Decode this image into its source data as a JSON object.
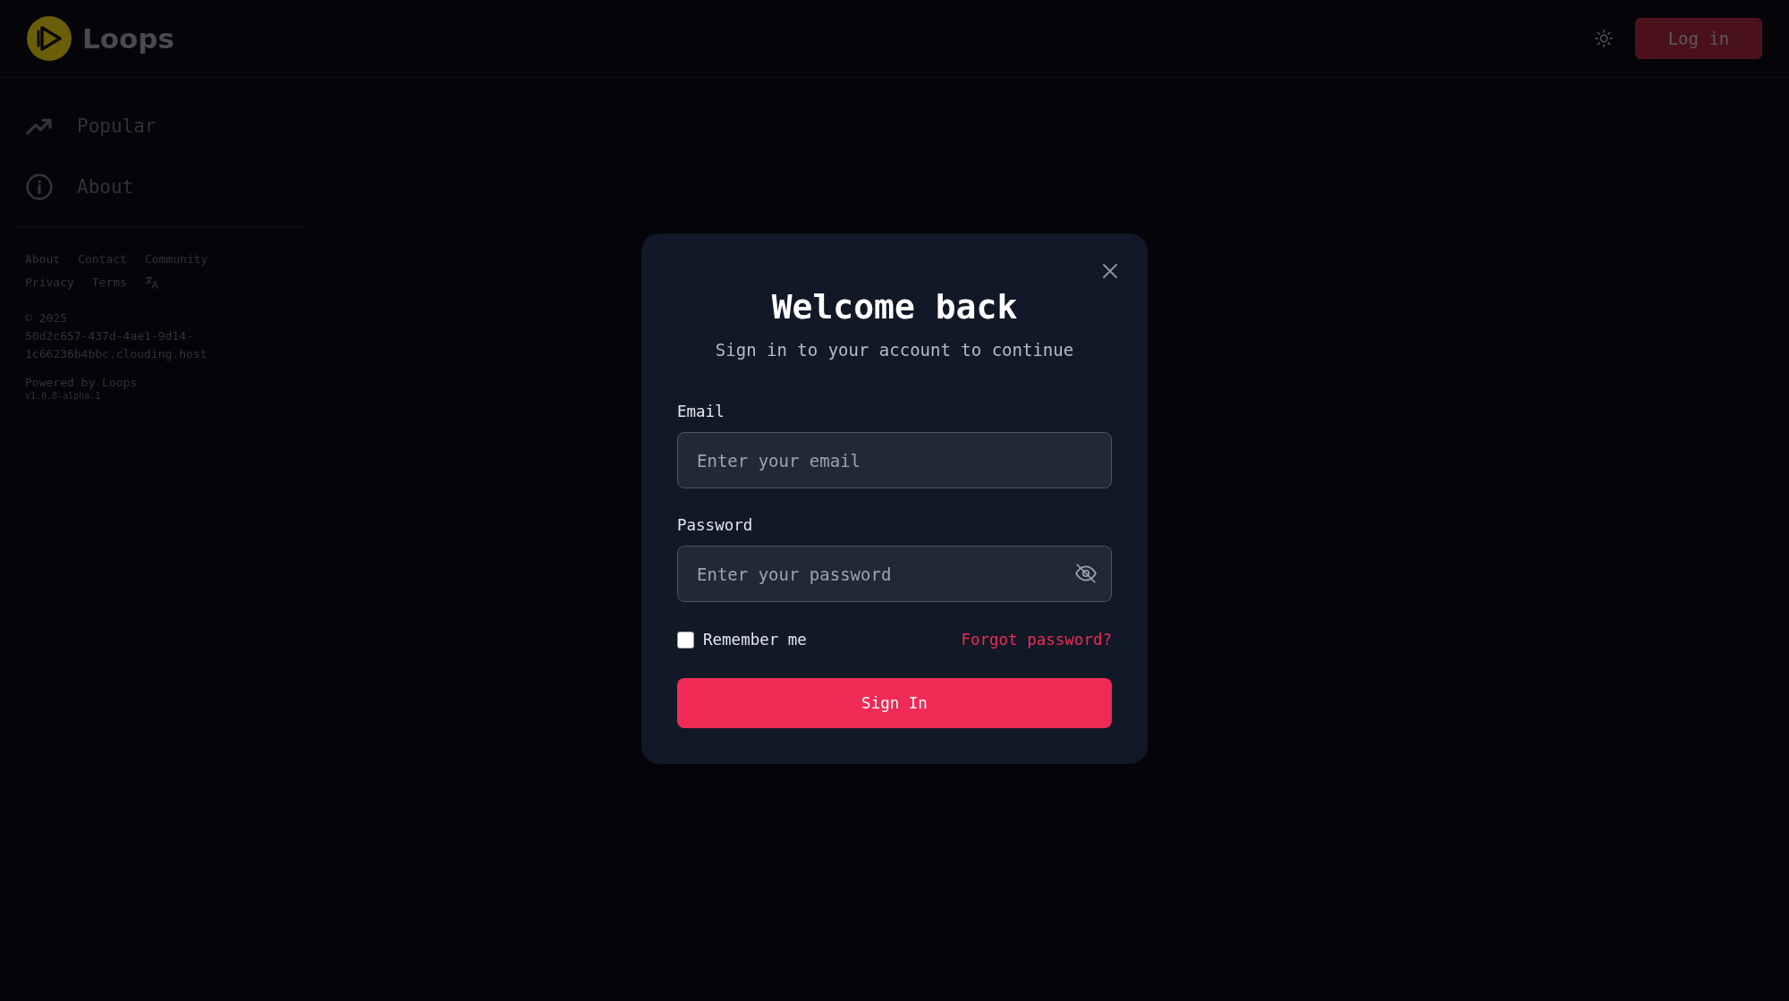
{
  "header": {
    "logo_text": "Loops",
    "login_button": "Log in"
  },
  "sidebar": {
    "nav": [
      {
        "kind": "trending",
        "label": "Popular"
      },
      {
        "kind": "info",
        "label": "About"
      }
    ],
    "footer_links": [
      [
        "About",
        "Contact",
        "Community"
      ],
      [
        "Privacy",
        "Terms"
      ]
    ],
    "copyright": "© 2025",
    "host_lines": [
      "50d2c657-437d-4ae1-9d14-",
      "1c66236b4bbc.clouding.host"
    ],
    "powered": "Powered by Loops",
    "version": "v1.0.0-alpha.1"
  },
  "modal": {
    "title": "Welcome back",
    "subtitle": "Sign in to your account to continue",
    "fields": [
      {
        "kind": "email",
        "label": "Email",
        "placeholder": "Enter your email"
      },
      {
        "kind": "password",
        "label": "Password",
        "placeholder": "Enter your password",
        "visible": false
      }
    ],
    "remember": {
      "label": "Remember me",
      "checked": false
    },
    "forgot_link": "Forgot password?",
    "submit": "Sign In"
  }
}
